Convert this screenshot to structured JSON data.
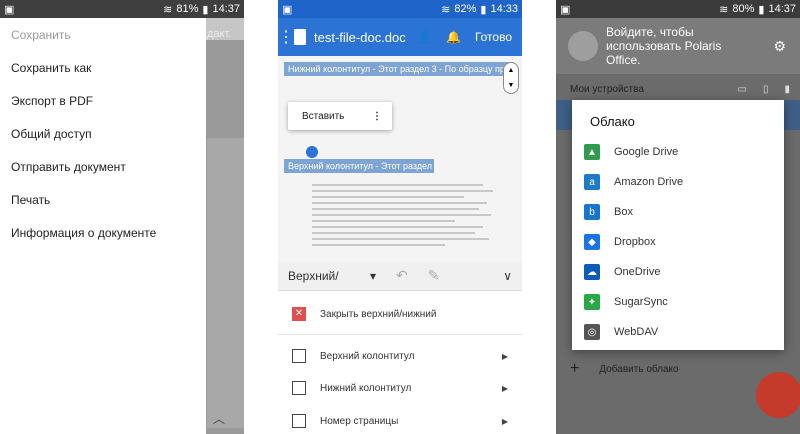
{
  "screen1": {
    "status": {
      "battery": "81%",
      "time": "14:37"
    },
    "bg_text": "дакт.",
    "menu": [
      {
        "label": "Сохранить",
        "disabled": true
      },
      {
        "label": "Сохранить как"
      },
      {
        "label": "Экспорт в PDF"
      },
      {
        "label": "Общий доступ"
      },
      {
        "label": "Отправить документ"
      },
      {
        "label": "Печать"
      },
      {
        "label": "Информация о документе"
      }
    ]
  },
  "screen2": {
    "status": {
      "battery": "82%",
      "time": "14:33"
    },
    "title": "test-file-doc.doc",
    "done_label": "Готово",
    "footer_bar": "Нижний колонтитул - Этот раздел 3 - По образцу преды",
    "header_bar": "Верхний колонтитул - Этот раздел 4",
    "paste_label": "Вставить",
    "selector_label": "Верхний/",
    "close_label": "Закрыть верхний/нижний",
    "rows": [
      "Верхний колонтитул",
      "Нижний колонтитул",
      "Номер страницы"
    ]
  },
  "screen3": {
    "status": {
      "battery": "80%",
      "time": "14:37"
    },
    "account_text": "Войдите, чтобы использовать Polaris Office.",
    "devices_label": "Мои устройства",
    "dialog_title": "Облако",
    "clouds": [
      {
        "label": "Google Drive",
        "icon": "google-drive-icon",
        "color": "#2e9b4e"
      },
      {
        "label": "Amazon Drive",
        "icon": "amazon-drive-icon",
        "color": "#1f7bc7"
      },
      {
        "label": "Box",
        "icon": "box-icon",
        "color": "#1a75d2"
      },
      {
        "label": "Dropbox",
        "icon": "dropbox-icon",
        "color": "#1a73e8"
      },
      {
        "label": "OneDrive",
        "icon": "onedrive-icon",
        "color": "#0a5cb8"
      },
      {
        "label": "SugarSync",
        "icon": "sugarsync-icon",
        "color": "#2aa845"
      },
      {
        "label": "WebDAV",
        "icon": "webdav-icon",
        "color": "#555555"
      }
    ],
    "add_cloud_label": "Добавить облако"
  }
}
